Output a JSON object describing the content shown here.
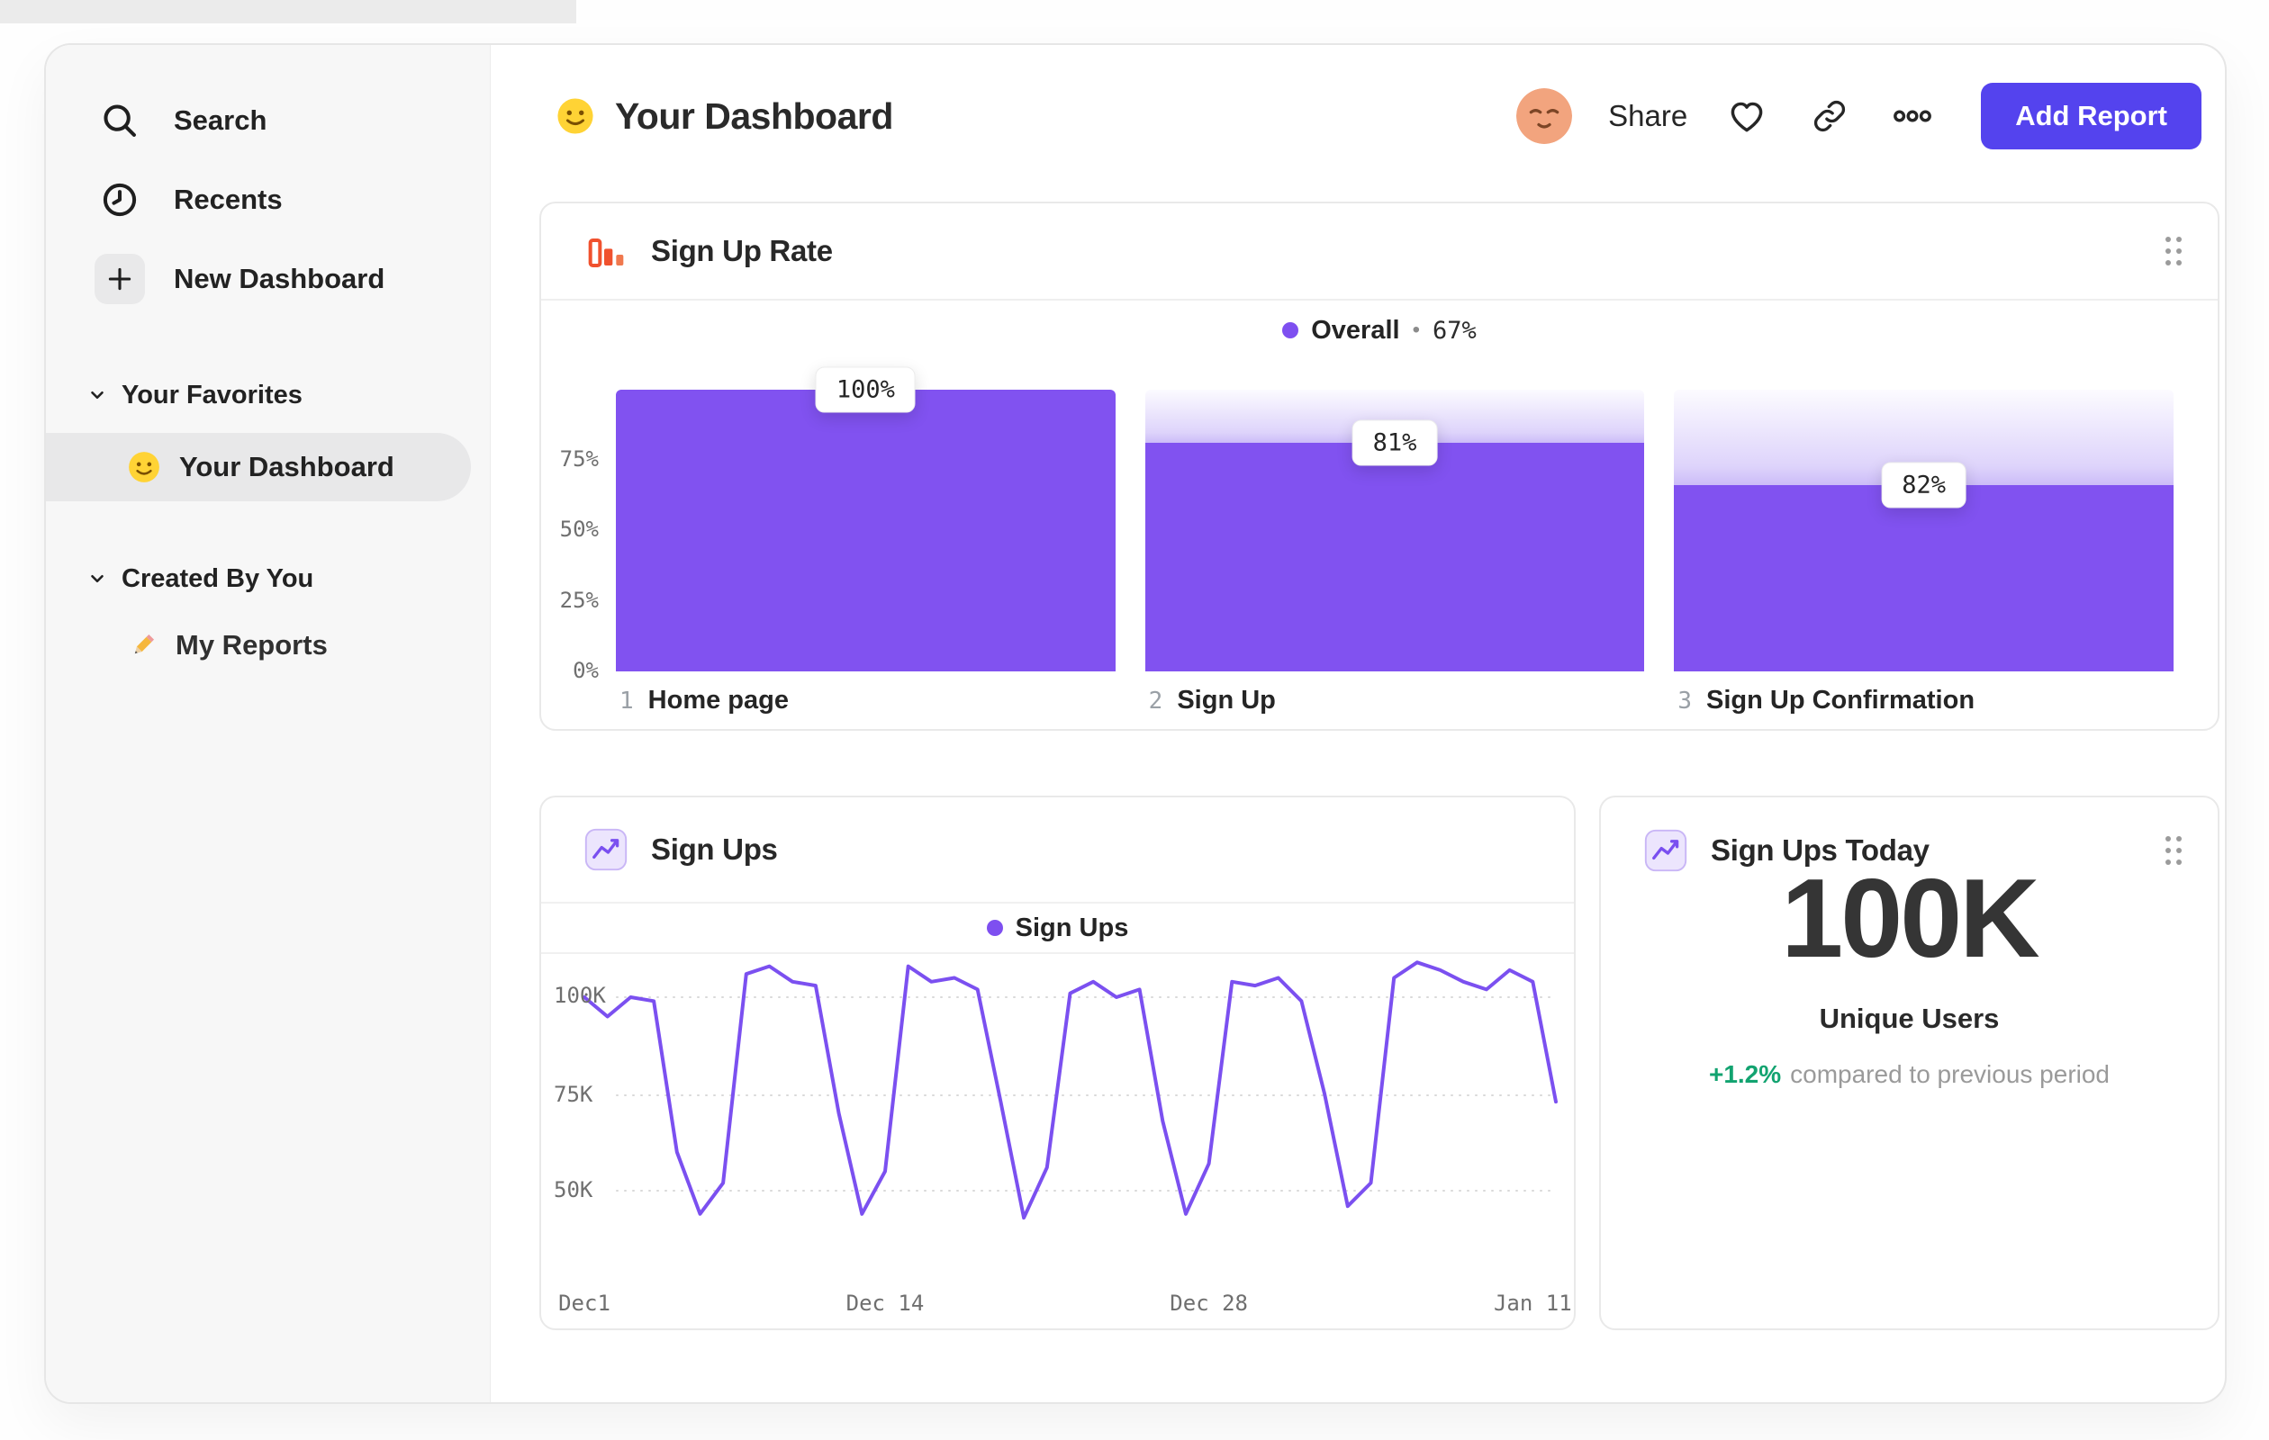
{
  "colors": {
    "accent_purple": "#7e4ff0",
    "bar_fill_purple": "#8152f0",
    "button_purple": "#5443ee",
    "icon_orange": "#f0512e",
    "positive_green": "#12a370",
    "sidebar_bg": "#f7f7f7"
  },
  "sidebar": {
    "search": "Search",
    "recents": "Recents",
    "new_dashboard": "New Dashboard",
    "favorites_header": "Your Favorites",
    "favorite_item": "Your Dashboard",
    "created_header": "Created By You",
    "created_item": "My Reports"
  },
  "header": {
    "title": "Your Dashboard",
    "share": "Share",
    "add_report": "Add Report"
  },
  "chart_data": [
    {
      "type": "bar",
      "title": "Sign Up Rate",
      "legend_label": "Overall",
      "legend_sep": "•",
      "legend_value": "67%",
      "y_ticks": [
        "75%",
        "50%",
        "25%",
        "0%"
      ],
      "ylim": [
        "0%",
        "100%"
      ],
      "steps": [
        {
          "index": "1",
          "label": "Home page",
          "value": "100%",
          "height_frac": 1.0
        },
        {
          "index": "2",
          "label": "Sign Up",
          "value": "81%",
          "height_frac": 0.81
        },
        {
          "index": "3",
          "label": "Sign Up Confirmation",
          "value": "82%",
          "height_frac": 0.66
        }
      ]
    },
    {
      "type": "line",
      "title": "Sign Ups",
      "legend_label": "Sign Ups",
      "y_ticks": [
        "100K",
        "75K",
        "50K"
      ],
      "x_ticks": [
        "Dec1",
        "Dec 14",
        "Dec 28",
        "Jan 11"
      ],
      "x_tick_days": [
        0,
        13,
        27,
        41
      ],
      "ylim_k": [
        40,
        112
      ],
      "series": [
        {
          "name": "Sign Ups",
          "unit": "K",
          "points": [
            100,
            95,
            100,
            99,
            60,
            44,
            52,
            106,
            108,
            104,
            103,
            70,
            44,
            55,
            108,
            104,
            105,
            102,
            73,
            43,
            56,
            101,
            104,
            100,
            102,
            68,
            44,
            57,
            104,
            103,
            105,
            99,
            75,
            46,
            52,
            105,
            109,
            107,
            104,
            102,
            107,
            104,
            73
          ]
        }
      ]
    },
    {
      "type": "metric",
      "title": "Sign Ups Today",
      "value": "100K",
      "label": "Unique Users",
      "delta": "+1.2%",
      "delta_note": "compared to previous period"
    }
  ]
}
